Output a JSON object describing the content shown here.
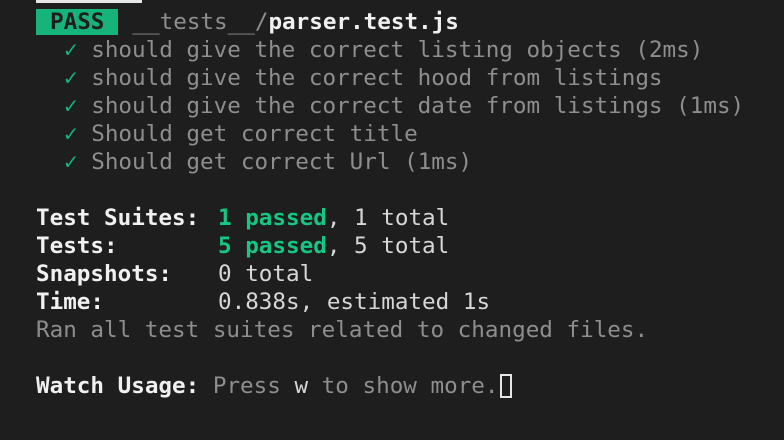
{
  "header": {
    "status_badge": "PASS",
    "file_dir": "__tests__/",
    "file_name": "parser.test.js"
  },
  "tests": [
    {
      "check": "✓",
      "name": "should give the correct listing objects",
      "time": " (2ms)"
    },
    {
      "check": "✓",
      "name": "should give the correct hood from listings",
      "time": ""
    },
    {
      "check": "✓",
      "name": "should give the correct date from listings",
      "time": " (1ms)"
    },
    {
      "check": "✓",
      "name": "Should get correct title",
      "time": ""
    },
    {
      "check": "✓",
      "name": "Should get correct Url",
      "time": " (1ms)"
    }
  ],
  "summary": {
    "suites_label": "Test Suites:",
    "suites_passed": "1 passed",
    "suites_total": ", 1 total",
    "tests_label": "Tests:",
    "tests_passed": "5 passed",
    "tests_total": ", 5 total",
    "snapshots_label": "Snapshots:",
    "snapshots_value": "0 total",
    "time_label": "Time:",
    "time_value": "0.838s, estimated 1s",
    "ran_all": "Ran all test suites related to changed files."
  },
  "watch": {
    "label": "Watch Usage:",
    "press": "Press ",
    "key": "w",
    "rest": " to show more."
  },
  "colors": {
    "background": "#1e1e1e",
    "pass_green": "#16b37a",
    "dim_text": "#8e8e8e",
    "bright_text": "#f0f0f0"
  }
}
